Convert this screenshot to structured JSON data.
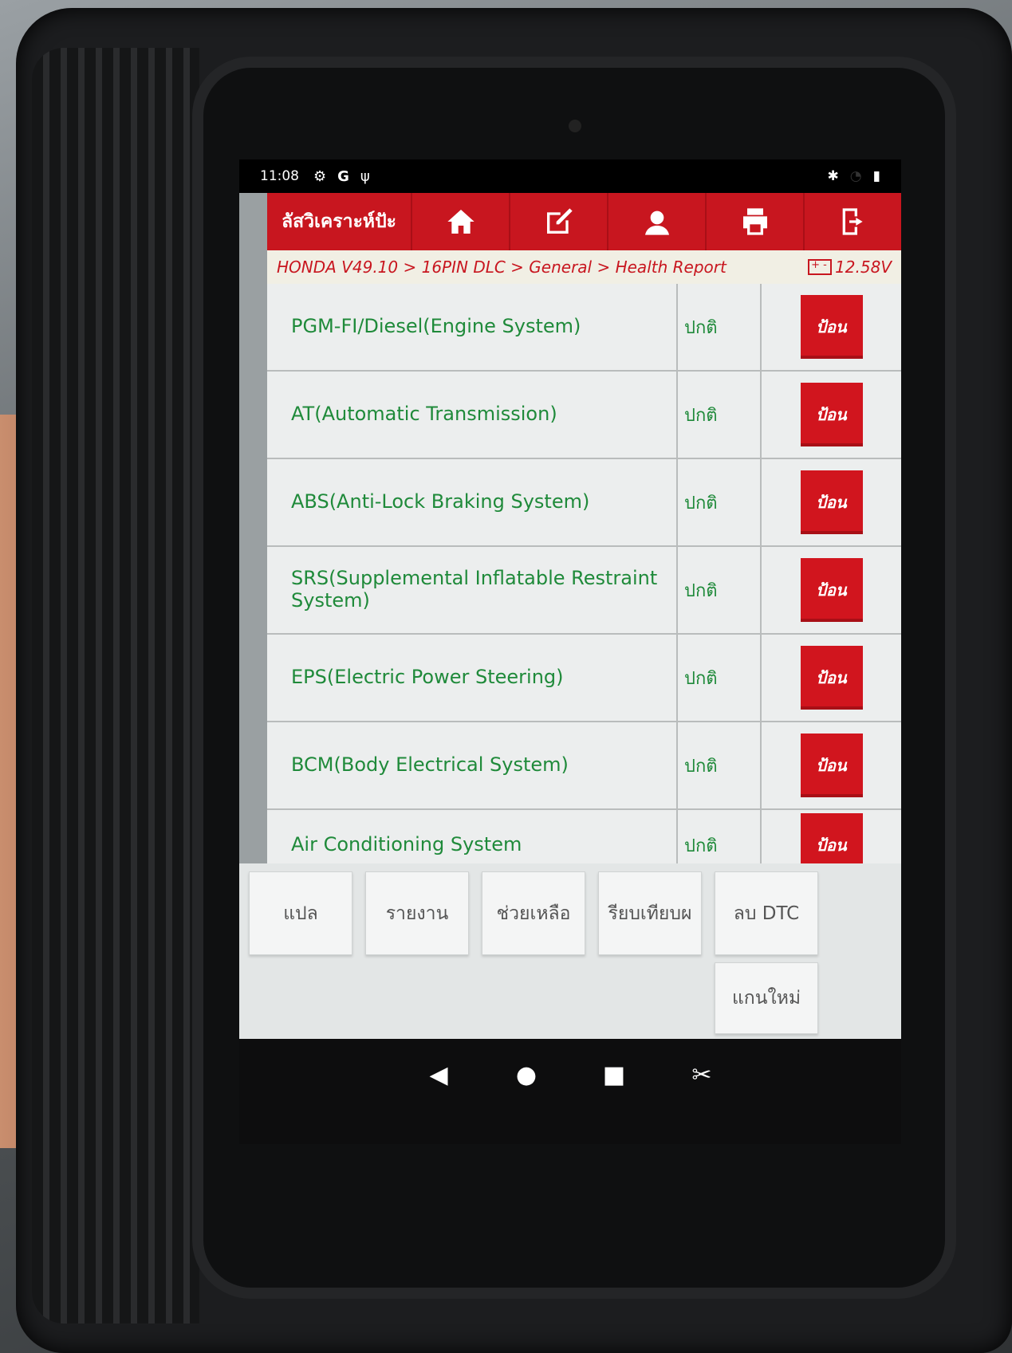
{
  "status_bar": {
    "time": "11:08",
    "icons_left": [
      "settings-icon",
      "google-icon",
      "usb-debug-icon"
    ],
    "icons_right": [
      "bluetooth-icon",
      "signal-icon",
      "battery-icon"
    ]
  },
  "toolbar": {
    "title": "ลัสวิเคราะห์ปัะ",
    "buttons": [
      "home-icon",
      "edit-icon",
      "user-icon",
      "print-icon",
      "exit-icon"
    ]
  },
  "breadcrumb": {
    "path": "HONDA V49.10 > 16PIN DLC > General > Health Report",
    "voltage": "12.58V"
  },
  "systems": [
    {
      "name": "PGM-FI/Diesel(Engine System)",
      "status": "ปกติ",
      "action": "ป้อน"
    },
    {
      "name": "AT(Automatic Transmission)",
      "status": "ปกติ",
      "action": "ป้อน"
    },
    {
      "name": "ABS(Anti-Lock Braking System)",
      "status": "ปกติ",
      "action": "ป้อน"
    },
    {
      "name": "SRS(Supplemental Inflatable Restraint System)",
      "status": "ปกติ",
      "action": "ป้อน"
    },
    {
      "name": "EPS(Electric Power Steering)",
      "status": "ปกติ",
      "action": "ป้อน"
    },
    {
      "name": "BCM(Body Electrical System)",
      "status": "ปกติ",
      "action": "ป้อน"
    },
    {
      "name": "Air Conditioning System",
      "status": "ปกติ",
      "action": "ป้อน"
    }
  ],
  "bottom_buttons": {
    "translate": "แปล",
    "report": "รายงาน",
    "help": "ช่วยเหลือ",
    "compare": "รียบเทียบผ",
    "clear_dtc": "ลบ DTC",
    "rescan": "แกนใหม่"
  },
  "nav_bar": [
    "back-icon",
    "home-circle-icon",
    "recents-icon",
    "screenshot-icon"
  ]
}
